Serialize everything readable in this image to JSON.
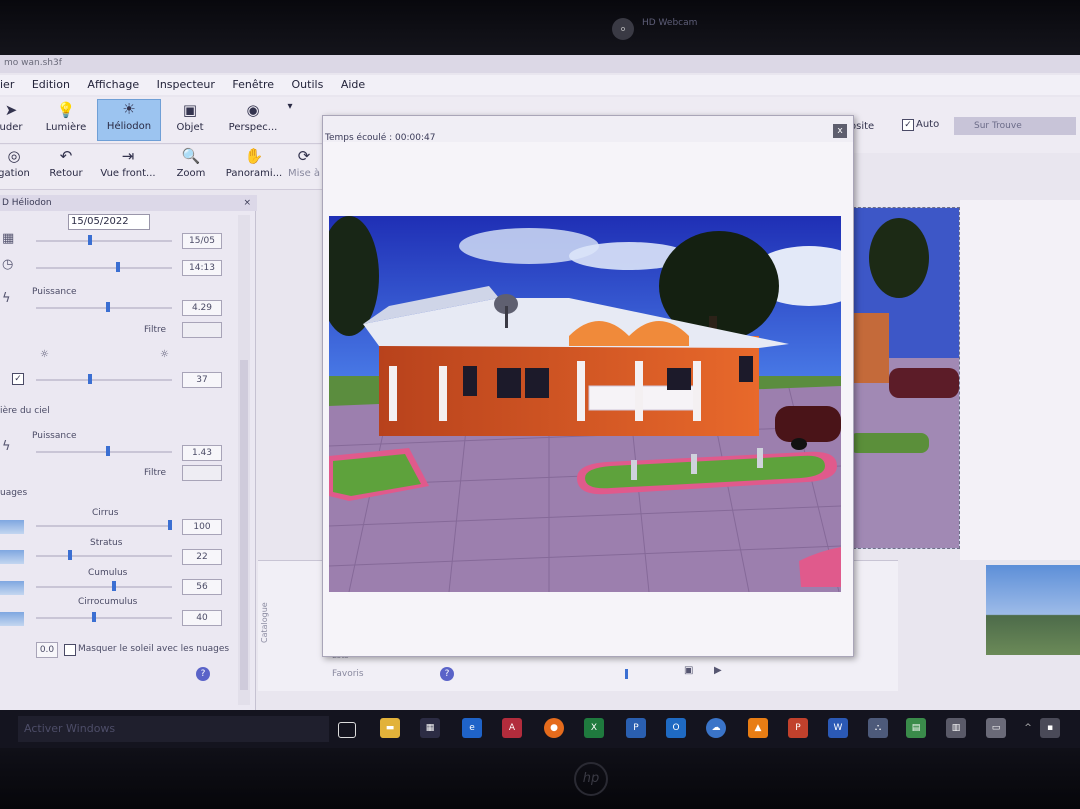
{
  "window": {
    "title": "mo wan.sh3f"
  },
  "menu": [
    "ier",
    "Edition",
    "Affichage",
    "Inspecteur",
    "Fenêtre",
    "Outils",
    "Aide"
  ],
  "toolbar1": [
    {
      "label": "uder",
      "icon": "pointer-icon"
    },
    {
      "label": "Lumière",
      "icon": "light-icon"
    },
    {
      "label": "Héliodon",
      "icon": "sun-icon"
    },
    {
      "label": "Objet",
      "icon": "cube-icon"
    },
    {
      "label": "Perspec...",
      "icon": "camera-icon"
    }
  ],
  "toolbar2": [
    {
      "label": "gation",
      "icon": "navigation-icon"
    },
    {
      "label": "Retour",
      "icon": "undo-icon"
    },
    {
      "label": "Vue front...",
      "icon": "front-view-icon"
    },
    {
      "label": "Zoom",
      "icon": "zoom-icon"
    },
    {
      "label": "Panorami...",
      "icon": "pan-icon"
    },
    {
      "label": "Mise à",
      "icon": "update-icon"
    }
  ],
  "right_toolbar": {
    "osite": "osite",
    "auto_label": "Auto",
    "auto_checked": true,
    "dropdown": "Sur Trouve"
  },
  "heliodon": {
    "title": "D Héliodon",
    "date": "15/05/2022",
    "date_short": "15/05",
    "time": "14:13",
    "puissance_label": "Puissance",
    "puissance": "4.29",
    "filtre_label": "Filtre",
    "value_37": "37",
    "sky_section": "ière du ciel",
    "sky_puissance_label": "Puissance",
    "sky_puissance": "1.43",
    "sky_filtre_label": "Filtre",
    "clouds_section": "uages",
    "cirrus_label": "Cirrus",
    "cirrus": "100",
    "stratus_label": "Stratus",
    "stratus": "22",
    "cumulus_label": "Cumulus",
    "cumulus": "56",
    "cirrocumulus_label": "Cirrocumulus",
    "cirrocumulus": "40",
    "mask_label": "Masquer le soleil avec les nuages",
    "mask_value": "0.0"
  },
  "dialog": {
    "timer_label": "Temps écoulé : 00:00:47",
    "close": "x"
  },
  "catalog": {
    "label": "Catalogue",
    "favoris": "Favoris",
    "lots": "Lots"
  },
  "taskbar": {
    "search_placeholder": "Activer Windows"
  },
  "webcam": {
    "label": "HD Webcam"
  }
}
